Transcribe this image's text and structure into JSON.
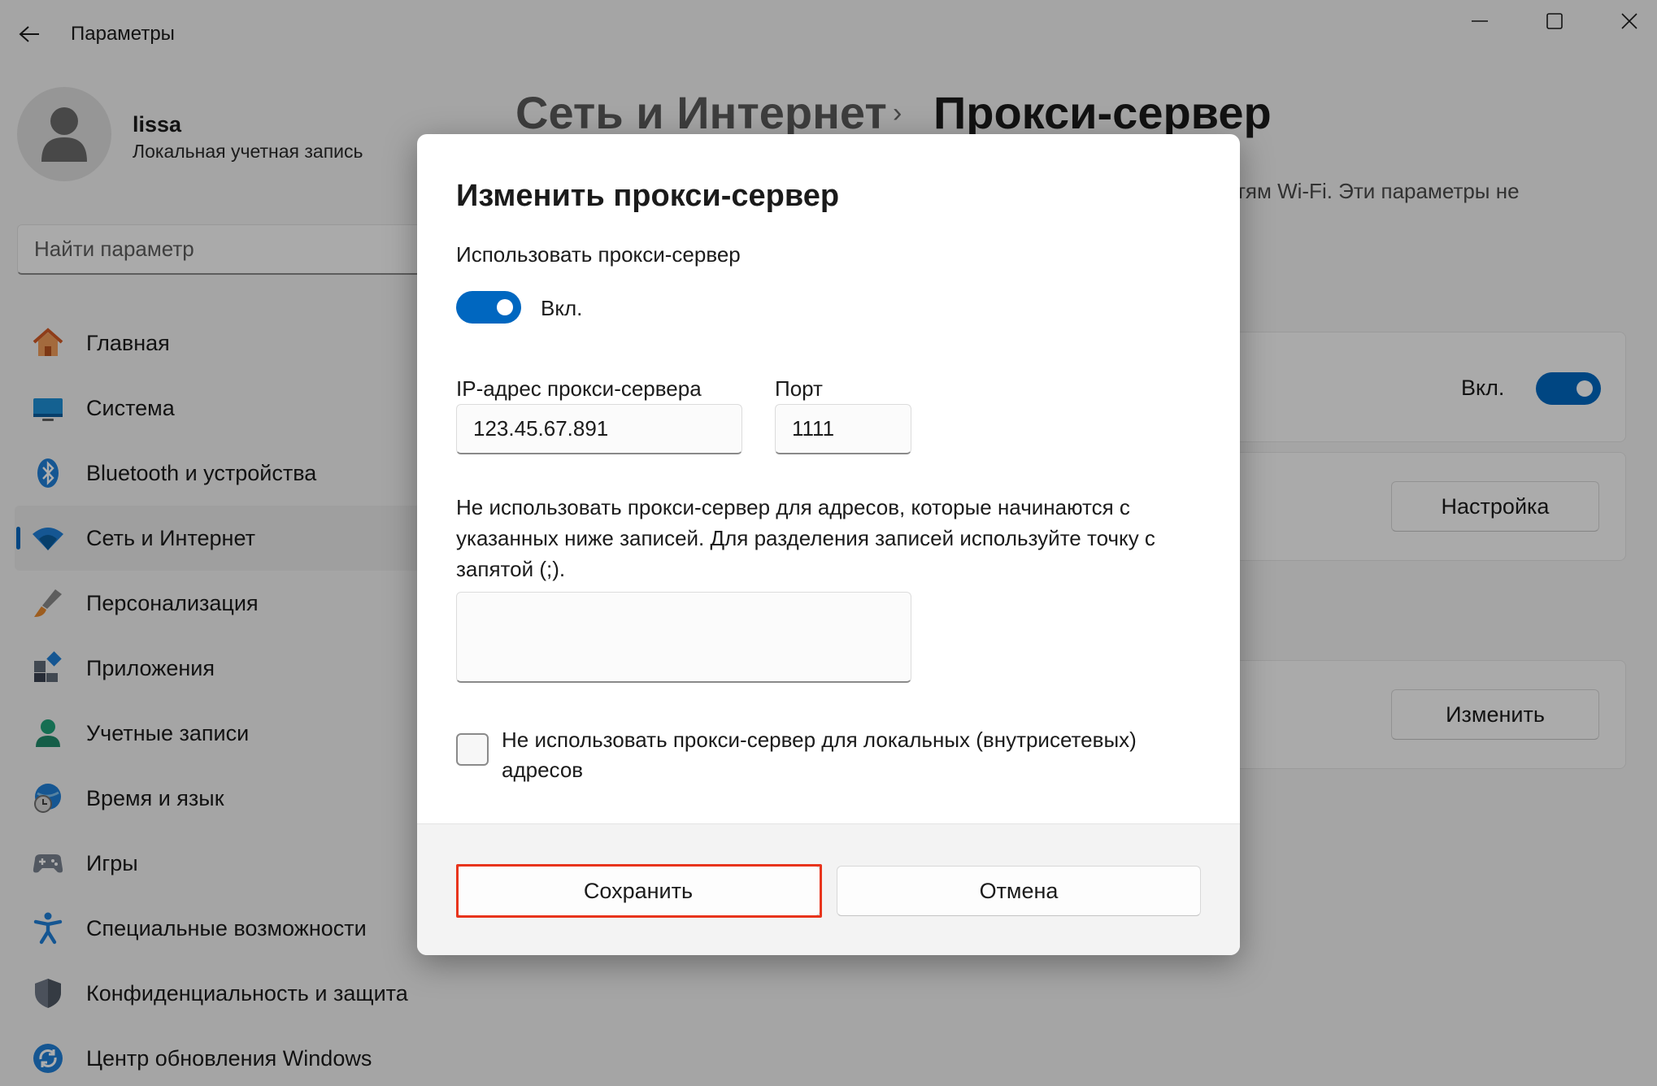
{
  "window": {
    "title": "Параметры",
    "back_icon": "arrow-left-icon",
    "minimize_icon": "minimize-icon",
    "maximize_icon": "maximize-icon",
    "close_icon": "close-icon"
  },
  "profile": {
    "name": "lissa",
    "account_type": "Локальная учетная запись"
  },
  "search": {
    "placeholder": "Найти параметр"
  },
  "sidebar": {
    "items": [
      {
        "label": "Главная",
        "icon": "home-icon"
      },
      {
        "label": "Система",
        "icon": "monitor-icon"
      },
      {
        "label": "Bluetooth и устройства",
        "icon": "bluetooth-icon"
      },
      {
        "label": "Сеть и Интернет",
        "icon": "wifi-icon",
        "active": true
      },
      {
        "label": "Персонализация",
        "icon": "brush-icon"
      },
      {
        "label": "Приложения",
        "icon": "apps-icon"
      },
      {
        "label": "Учетные записи",
        "icon": "person-icon"
      },
      {
        "label": "Время и язык",
        "icon": "globe-clock-icon"
      },
      {
        "label": "Игры",
        "icon": "gamepad-icon"
      },
      {
        "label": "Специальные возможности",
        "icon": "accessibility-icon"
      },
      {
        "label": "Конфиденциальность и защита",
        "icon": "shield-icon"
      },
      {
        "label": "Центр обновления Windows",
        "icon": "update-icon"
      }
    ]
  },
  "main": {
    "breadcrumb_parent": "Сеть и Интернет",
    "breadcrumb_separator": "›",
    "breadcrumb_current": "Прокси-сервер",
    "description_fragment": "тям Wi-Fi. Эти параметры не",
    "auto_detect_state": "Вкл.",
    "setup_button": "Настройка",
    "edit_button": "Изменить"
  },
  "dialog": {
    "title": "Изменить прокси-сервер",
    "use_proxy_label": "Использовать прокси-сервер",
    "use_proxy_state": "Вкл.",
    "use_proxy_on": true,
    "ip_label": "IP-адрес прокси-сервера",
    "ip_value": "123.45.67.891",
    "port_label": "Порт",
    "port_value": "1111",
    "exclude_description": "Не использовать прокси-сервер для адресов, которые начинаются с указанных ниже записей. Для разделения записей используйте точку с запятой (;).",
    "exclude_value": "",
    "local_bypass_label": "Не использовать прокси-сервер для локальных (внутрисетевых) адресов",
    "local_bypass_checked": false,
    "save_button": "Сохранить",
    "cancel_button": "Отмена"
  },
  "colors": {
    "accent": "#0067c0",
    "highlight": "#e8341c"
  }
}
